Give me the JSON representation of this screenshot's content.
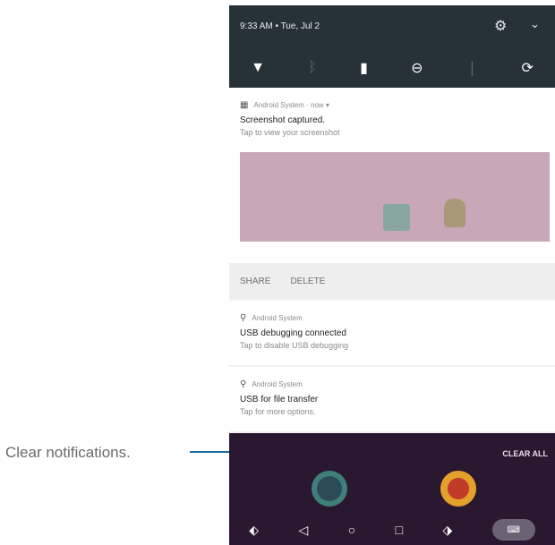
{
  "status_bar": {
    "time": "9:33 AM • Tue, Jul 2",
    "settings_icon": "gear-icon",
    "expand_icon": "chevron-down-icon"
  },
  "quick_settings": [
    {
      "icon": "wifi-icon",
      "glyph": "▼"
    },
    {
      "icon": "bluetooth-icon",
      "glyph": "ᛒ"
    },
    {
      "icon": "battery-icon",
      "glyph": "▮"
    },
    {
      "icon": "do-not-disturb-icon",
      "glyph": "⊖"
    },
    {
      "icon": "flashlight-icon",
      "glyph": "❘"
    },
    {
      "icon": "auto-rotate-icon",
      "glyph": "⟳"
    }
  ],
  "notifications": {
    "screenshot": {
      "app": "Android System · now ▾",
      "title": "Screenshot captured.",
      "text": "Tap to view your screenshot",
      "actions": [
        "SHARE",
        "DELETE"
      ]
    },
    "usb_debugging": {
      "app": "Android System",
      "title": "USB debugging connected",
      "text": "Tap to disable USB debugging"
    },
    "usb_transfer": {
      "app": "Android System",
      "title": "USB for file transfer",
      "text": "Tap for more options."
    }
  },
  "clear_all": "CLEAR ALL",
  "callout": {
    "label": "Clear notifications."
  },
  "colors": {
    "shade_dark": "#263238",
    "preview_bg": "#c8a8b8",
    "callout_line": "#1a6aa0"
  }
}
